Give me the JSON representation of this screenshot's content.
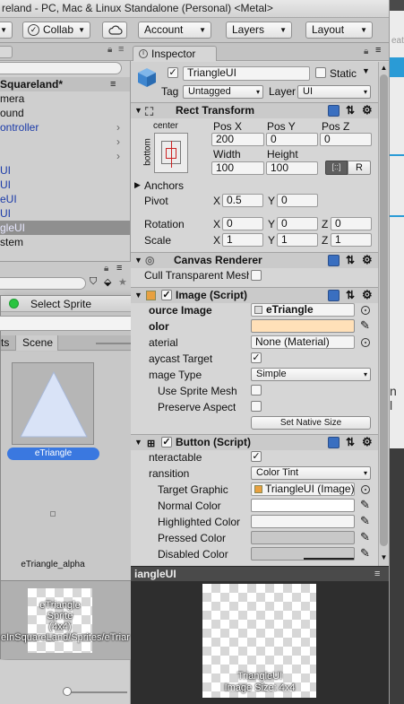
{
  "window": {
    "title": "reland - PC, Mac & Linux Standalone (Personal) <Metal>"
  },
  "toolbar": {
    "collab": "Collab",
    "account": "Account",
    "layers": "Layers",
    "layout": "Layout"
  },
  "hierarchy": {
    "scene": "Squareland*",
    "items": [
      "mera",
      "ound",
      "ontroller",
      "",
      "",
      "UI",
      "UI",
      "eUI",
      "UI",
      "gleUI",
      "stem"
    ]
  },
  "inspector": {
    "tab": "Inspector",
    "object_name": "TriangleUI",
    "static_label": "Static",
    "tag_label": "Tag",
    "tag_value": "Untagged",
    "layer_label": "Layer",
    "layer_value": "UI",
    "rect_transform": {
      "title": "Rect Transform",
      "anchor_preset": "center",
      "anchor_side": "bottom",
      "pos_x_label": "Pos X",
      "pos_y_label": "Pos Y",
      "pos_z_label": "Pos Z",
      "pos_x": "200",
      "pos_y": "0",
      "pos_z": "0",
      "width_label": "Width",
      "height_label": "Height",
      "width": "100",
      "height": "100",
      "r_button": "R",
      "anchors": "Anchors",
      "pivot_label": "Pivot",
      "pivot_x": "0.5",
      "pivot_y": "0",
      "rotation_label": "Rotation",
      "rot_x": "0",
      "rot_y": "0",
      "rot_z": "0",
      "scale_label": "Scale",
      "scale_x": "1",
      "scale_y": "1",
      "scale_z": "1",
      "x": "X",
      "y": "Y",
      "z": "Z"
    },
    "canvas_renderer": {
      "title": "Canvas Renderer",
      "cull_label": "Cull Transparent Mesh"
    },
    "image": {
      "title": "Image (Script)",
      "source_label": "ource Image",
      "source_value": "eTriangle",
      "color_label": "olor",
      "color_value": "#ffe0b8",
      "material_label": "aterial",
      "material_value": "None (Material)",
      "raycast_label": "aycast Target",
      "type_label": "mage Type",
      "type_value": "Simple",
      "use_sprite_mesh": "Use Sprite Mesh",
      "preserve_aspect": "Preserve Aspect",
      "set_native_size": "Set Native Size"
    },
    "button": {
      "title": "Button (Script)",
      "interactable_label": "nteractable",
      "transition_label": "ransition",
      "transition_value": "Color Tint",
      "target_graphic_label": "Target Graphic",
      "target_graphic_value": "TriangleUI (Image)",
      "normal_color": "Normal Color",
      "highlighted_color": "Highlighted Color",
      "pressed_color": "Pressed Color",
      "disabled_color": "Disabled Color"
    }
  },
  "select_sprite": {
    "title": "Select Sprite",
    "tab_assets": "ts",
    "tab_scene": "Scene",
    "item1": "eTriangle",
    "item2": "eTriangle_alpha",
    "preview_name": "eTriangle",
    "preview_type": "Sprite",
    "preview_size": "(4x4)",
    "preview_path": "eInSquareLand/Sprites/eTriar"
  },
  "preview": {
    "header": "iangleUI",
    "name": "TriangleUI",
    "size": "Image Size: 4x4"
  },
  "right_panel": {
    "text_1": "eate",
    "text_2": "n l"
  }
}
